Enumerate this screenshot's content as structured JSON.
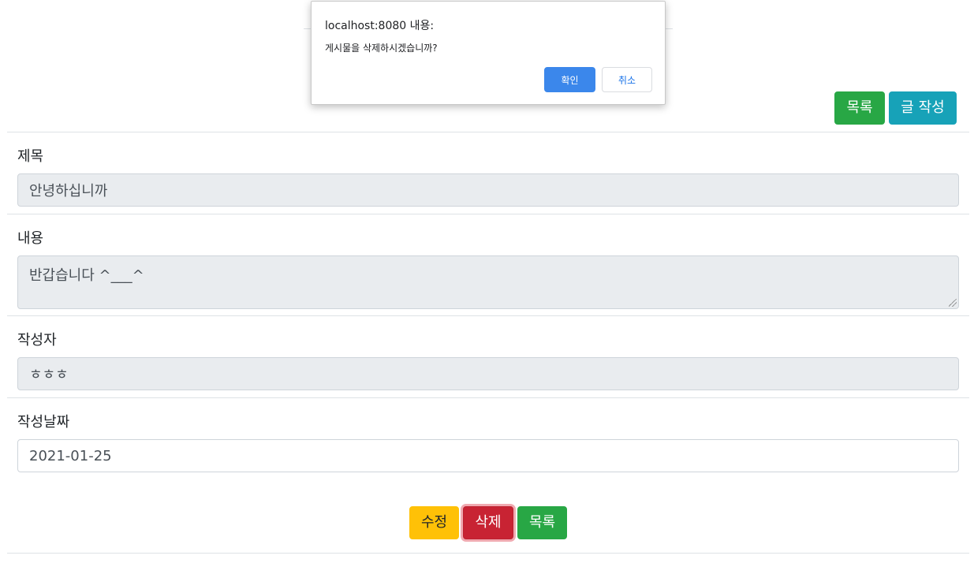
{
  "header": {
    "list_label": "목록",
    "write_label": "글 작성"
  },
  "form": {
    "title": {
      "label": "제목",
      "value": "안녕하십니까"
    },
    "content": {
      "label": "내용",
      "value": "반갑습니다 ^___^"
    },
    "writer": {
      "label": "작성자",
      "value": "ㅎㅎㅎ"
    },
    "date": {
      "label": "작성날짜",
      "value": "2021-01-25"
    }
  },
  "actions": {
    "edit_label": "수정",
    "delete_label": "삭제",
    "list_label": "목록"
  },
  "dialog": {
    "title": "localhost:8080 내용:",
    "message": "게시물을 삭제하시겠습니까?",
    "ok_label": "확인",
    "cancel_label": "취소"
  },
  "colors": {
    "success": "#28a745",
    "info": "#17a2b8",
    "warning": "#ffc107",
    "danger": "#c82333",
    "dialog_ok": "#1a73e8"
  }
}
